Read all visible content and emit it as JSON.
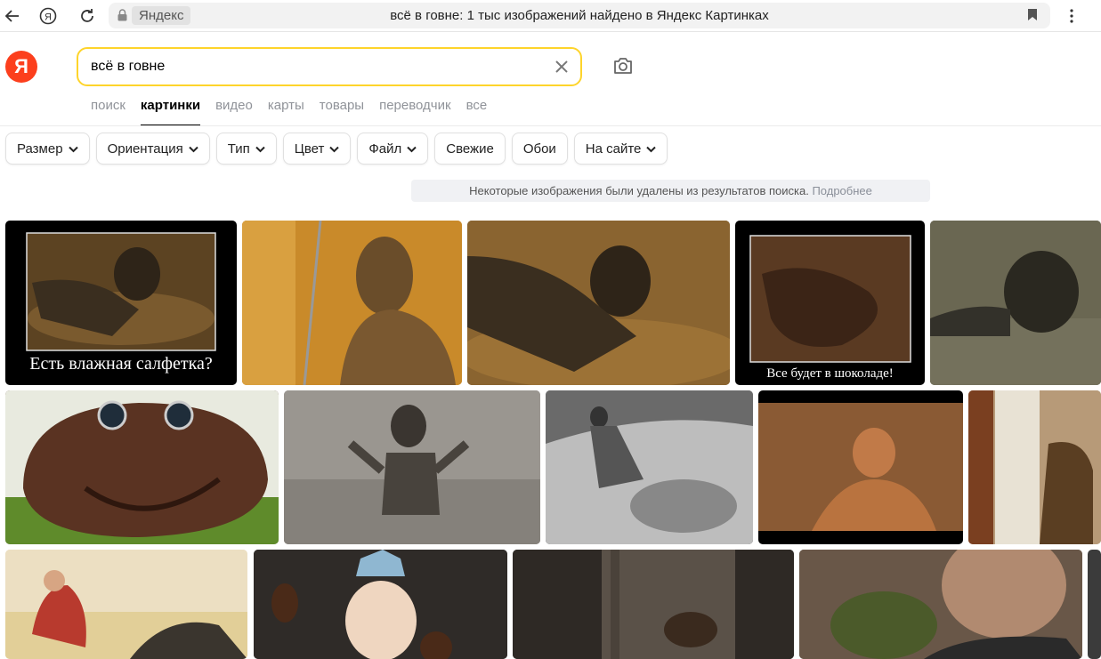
{
  "browser": {
    "site_chip": "Яндекс",
    "page_title": "всё в говне: 1 тыс изображений найдено в Яндекс Картинках"
  },
  "header": {
    "logo_letter": "Я",
    "search_value": "всё в говне"
  },
  "tabs": [
    {
      "label": "поиск",
      "active": false
    },
    {
      "label": "картинки",
      "active": true
    },
    {
      "label": "видео",
      "active": false
    },
    {
      "label": "карты",
      "active": false
    },
    {
      "label": "товары",
      "active": false
    },
    {
      "label": "переводчик",
      "active": false
    },
    {
      "label": "все",
      "active": false
    }
  ],
  "filters": [
    {
      "label": "Размер",
      "dropdown": true
    },
    {
      "label": "Ориентация",
      "dropdown": true
    },
    {
      "label": "Тип",
      "dropdown": true
    },
    {
      "label": "Цвет",
      "dropdown": true
    },
    {
      "label": "Файл",
      "dropdown": true
    },
    {
      "label": "Свежие",
      "dropdown": false
    },
    {
      "label": "Обои",
      "dropdown": false
    },
    {
      "label": "На сайте",
      "dropdown": true
    }
  ],
  "notice": {
    "text": "Некоторые изображения были удалены из результатов поиска.",
    "link": "Подробнее"
  },
  "results": [
    {
      "caption": "Есть влажная салфетка?"
    },
    {
      "caption": ""
    },
    {
      "caption": ""
    },
    {
      "caption": "Все будет в шоколаде!"
    },
    {
      "caption": ""
    },
    {
      "caption": ""
    },
    {
      "caption": ""
    },
    {
      "caption": ""
    },
    {
      "caption": ""
    },
    {
      "caption": ""
    },
    {
      "caption": ""
    },
    {
      "caption": ""
    },
    {
      "caption": ""
    },
    {
      "caption": ""
    },
    {
      "caption": ""
    }
  ]
}
